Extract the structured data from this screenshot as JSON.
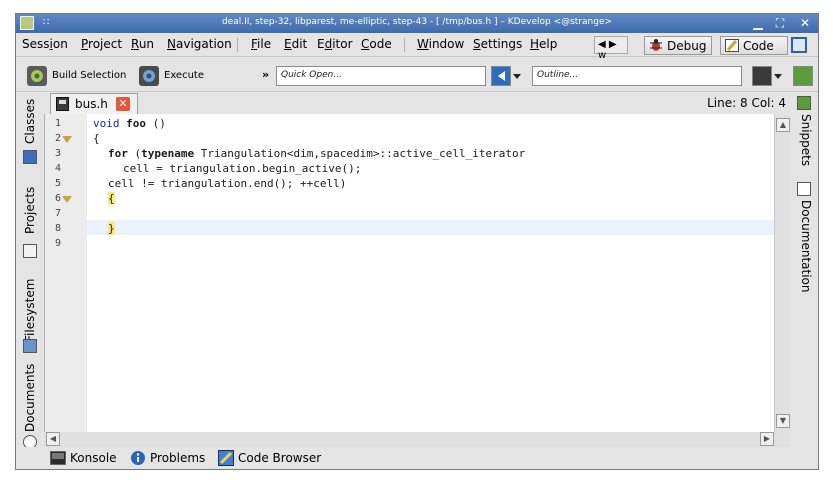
{
  "window": {
    "title": "deal.II, step-32, libparest, me-elliptic, step-43 - [ /tmp/bus.h ] – KDevelop <@strange>",
    "grip": "∷",
    "minimize_glyph": "▁",
    "maximize_glyph": "⛶",
    "close_glyph": "✕"
  },
  "menubar": {
    "items": [
      {
        "pre": "Sess",
        "u": "i",
        "post": "on"
      },
      {
        "pre": "",
        "u": "P",
        "post": "roject"
      },
      {
        "pre": "",
        "u": "R",
        "post": "un"
      },
      {
        "pre": "",
        "u": "N",
        "post": "avigation"
      },
      {
        "pre": "",
        "u": "F",
        "post": "ile"
      },
      {
        "pre": "",
        "u": "E",
        "post": "dit"
      },
      {
        "pre": "E",
        "u": "d",
        "post": "itor"
      },
      {
        "pre": "",
        "u": "C",
        "post": "ode"
      },
      {
        "pre": "",
        "u": "W",
        "post": "indow"
      },
      {
        "pre": "",
        "u": "S",
        "post": "ettings"
      },
      {
        "pre": "",
        "u": "H",
        "post": "elp"
      }
    ],
    "area_arrows": "◀ ▶ w",
    "area_debug": "Debug",
    "area_code": "Code",
    "colors": {
      "debug_icon": "#c0392b",
      "code_icon": "#d4a32b"
    }
  },
  "toolbar": {
    "build_selection": "Build Selection",
    "execute": "Execute",
    "chevron": "»",
    "quick_open_placeholder": "Quick Open...",
    "outline_placeholder": "Outline..."
  },
  "left_panel": {
    "tabs": [
      "Classes",
      "Projects",
      "Filesystem",
      "Documents"
    ]
  },
  "right_panel": {
    "tabs": [
      "Snippets",
      "Documentation"
    ]
  },
  "document": {
    "tab_label": "bus.h",
    "close_glyph": "✕",
    "cursor_position": "Line: 8 Col: 4"
  },
  "editor": {
    "line_numbers": [
      "1",
      "2",
      "3",
      "4",
      "5",
      "6",
      "7",
      "8",
      "9"
    ],
    "code": {
      "l1_kw": "void",
      "l1_name": "foo",
      "l1_rest": " ()",
      "l2": "{",
      "l3_kw1": "for",
      "l3_mid": " (",
      "l3_kw2": "typename",
      "l3_rest": " Triangulation<dim,spacedim>::active_cell_iterator",
      "l4": "cell = triangulation.begin_active();",
      "l5": "cell != triangulation.end(); ++cell)",
      "l6": "{",
      "l8": "}"
    },
    "highlight_color": "#ffe97a",
    "current_line_color": "#eaf2fb"
  },
  "bottombar": {
    "konsole": "Konsole",
    "problems": "Problems",
    "code_browser": "Code Browser"
  }
}
